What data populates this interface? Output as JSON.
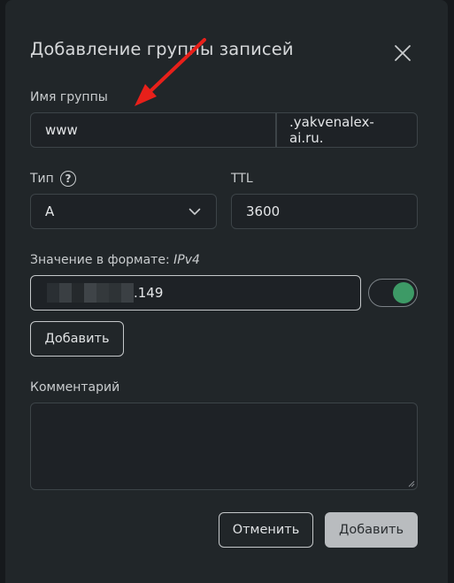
{
  "dialog": {
    "title": "Добавление группы записей"
  },
  "group_name": {
    "label": "Имя группы",
    "value": "www",
    "domain_suffix": ".yakvenalex-ai.ru."
  },
  "type": {
    "label": "Тип",
    "help_glyph": "?",
    "selected": "A"
  },
  "ttl": {
    "label": "TTL",
    "value": "3600"
  },
  "value": {
    "label_prefix": "Значение в формате:",
    "label_format": "IPv4",
    "visible_suffix": ".149",
    "enabled": true
  },
  "add_value_button": "Добавить",
  "comment": {
    "label": "Комментарий",
    "value": ""
  },
  "footer": {
    "cancel": "Отменить",
    "submit": "Добавить"
  },
  "colors": {
    "background": "#212629",
    "toggle_on": "#3d9a66",
    "annotation_arrow": "#e8201a"
  },
  "icons": {
    "close": "close-icon",
    "help": "help-circle-icon",
    "dropdown": "chevron-down-icon",
    "annotation": "red-arrow-annotation"
  }
}
